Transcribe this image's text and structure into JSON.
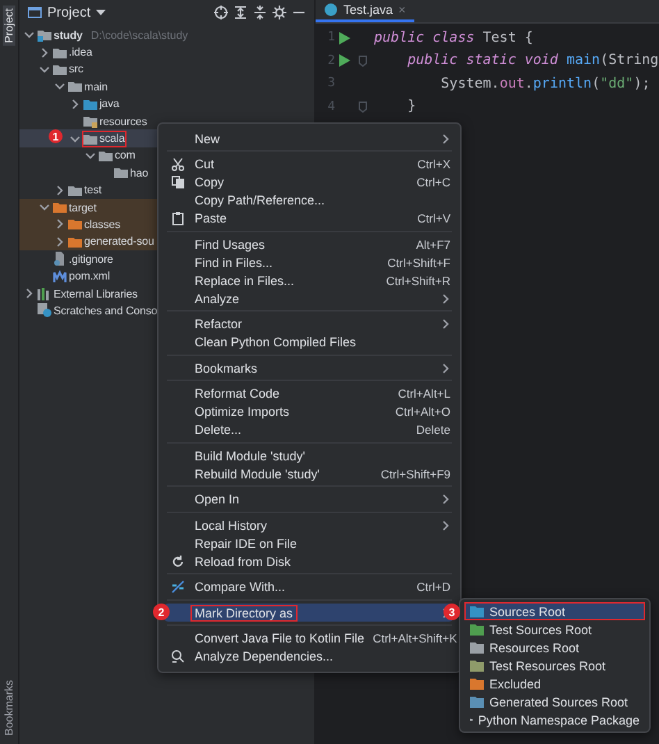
{
  "side_tabs": {
    "top": "Project",
    "bottom": "Bookmarks"
  },
  "project_panel": {
    "title": "Project"
  },
  "tree": [
    {
      "label": "study",
      "path": "D:\\code\\scala\\study",
      "kind": "module",
      "expanded": true,
      "selected": false,
      "outlined": false,
      "children": [
        {
          "label": ".idea",
          "kind": "folder",
          "expanded": false,
          "selected": false,
          "outlined": false
        },
        {
          "label": "src",
          "kind": "folder",
          "expanded": true,
          "selected": false,
          "outlined": false,
          "children": [
            {
              "label": "main",
              "kind": "folder",
              "expanded": true,
              "selected": false,
              "outlined": false,
              "children": [
                {
                  "label": "java",
                  "kind": "source",
                  "expanded": false,
                  "selected": false,
                  "outlined": false
                },
                {
                  "label": "resources",
                  "kind": "resource",
                  "selected": false,
                  "outlined": false
                },
                {
                  "label": "scala",
                  "kind": "folder",
                  "expanded": true,
                  "selected": true,
                  "outlined": true,
                  "children": [
                    {
                      "label": "com",
                      "kind": "folder",
                      "expanded": true,
                      "selected": false,
                      "outlined": false,
                      "children": [
                        {
                          "label": "hao",
                          "kind": "folder",
                          "selected": false,
                          "outlined": false
                        }
                      ]
                    }
                  ]
                }
              ]
            },
            {
              "label": "test",
              "kind": "folder",
              "expanded": false,
              "selected": false,
              "outlined": false
            }
          ]
        },
        {
          "label": "target",
          "kind": "excluded",
          "expanded": true,
          "selected": false,
          "outlined": false,
          "children": [
            {
              "label": "classes",
              "kind": "excluded",
              "expanded": false,
              "selected": false,
              "outlined": false
            },
            {
              "label": "generated-sou",
              "kind": "excluded",
              "expanded": false,
              "selected": false,
              "outlined": false
            }
          ]
        },
        {
          "label": ".gitignore",
          "kind": "gitfile",
          "selected": false,
          "outlined": false
        },
        {
          "label": "pom.xml",
          "kind": "maven",
          "selected": false,
          "outlined": false
        }
      ]
    },
    {
      "label": "External Libraries",
      "kind": "libraries",
      "expanded": false,
      "selected": false,
      "outlined": false
    },
    {
      "label": "Scratches and Conso",
      "kind": "scratches",
      "selected": false,
      "outlined": false
    }
  ],
  "editor_tab": {
    "label": "Test.java",
    "close": "×"
  },
  "code_lines": [
    {
      "number": "1",
      "run": true,
      "fold": false,
      "tokens": [
        {
          "text": "public class",
          "kind": "keyword"
        },
        {
          "text": " Test {",
          "kind": "plain"
        }
      ]
    },
    {
      "number": "2",
      "run": true,
      "fold": true,
      "tokens": [
        {
          "text": "    public static void",
          "kind": "keyword"
        },
        {
          "text": " main",
          "kind": "function"
        },
        {
          "text": "(String",
          "kind": "plain"
        }
      ]
    },
    {
      "number": "3",
      "run": false,
      "fold": false,
      "tokens": [
        {
          "text": "        System.",
          "kind": "plain"
        },
        {
          "text": "out",
          "kind": "field"
        },
        {
          "text": ".",
          "kind": "plain"
        },
        {
          "text": "println",
          "kind": "function"
        },
        {
          "text": "(",
          "kind": "plain"
        },
        {
          "text": "\"dd\"",
          "kind": "string"
        },
        {
          "text": ");",
          "kind": "plain"
        }
      ]
    },
    {
      "number": "4",
      "run": false,
      "fold": true,
      "tokens": [
        {
          "text": "    }",
          "kind": "plain"
        }
      ]
    }
  ],
  "context_menu": {
    "groups": [
      [
        {
          "label": "New",
          "submenu": true,
          "selected": false,
          "outlined": false
        }
      ],
      [
        {
          "label": "Cut",
          "shortcut": "Ctrl+X",
          "submenu": false,
          "selected": false,
          "outlined": false
        },
        {
          "label": "Copy",
          "shortcut": "Ctrl+C",
          "submenu": false,
          "selected": false,
          "outlined": false
        },
        {
          "label": "Copy Path/Reference...",
          "submenu": false,
          "selected": false,
          "outlined": false
        },
        {
          "label": "Paste",
          "shortcut": "Ctrl+V",
          "submenu": false,
          "selected": false,
          "outlined": false
        }
      ],
      [
        {
          "label": "Find Usages",
          "shortcut": "Alt+F7",
          "submenu": false,
          "selected": false,
          "outlined": false
        },
        {
          "label": "Find in Files...",
          "shortcut": "Ctrl+Shift+F",
          "submenu": false,
          "selected": false,
          "outlined": false
        },
        {
          "label": "Replace in Files...",
          "shortcut": "Ctrl+Shift+R",
          "submenu": false,
          "selected": false,
          "outlined": false
        },
        {
          "label": "Analyze",
          "submenu": true,
          "selected": false,
          "outlined": false
        }
      ],
      [
        {
          "label": "Refactor",
          "submenu": true,
          "selected": false,
          "outlined": false
        },
        {
          "label": "Clean Python Compiled Files",
          "submenu": false,
          "selected": false,
          "outlined": false
        }
      ],
      [
        {
          "label": "Bookmarks",
          "submenu": true,
          "selected": false,
          "outlined": false
        }
      ],
      [
        {
          "label": "Reformat Code",
          "shortcut": "Ctrl+Alt+L",
          "submenu": false,
          "selected": false,
          "outlined": false
        },
        {
          "label": "Optimize Imports",
          "shortcut": "Ctrl+Alt+O",
          "submenu": false,
          "selected": false,
          "outlined": false
        },
        {
          "label": "Delete...",
          "shortcut": "Delete",
          "submenu": false,
          "selected": false,
          "outlined": false
        }
      ],
      [
        {
          "label": "Build Module 'study'",
          "submenu": false,
          "selected": false,
          "outlined": false
        },
        {
          "label": "Rebuild Module 'study'",
          "shortcut": "Ctrl+Shift+F9",
          "submenu": false,
          "selected": false,
          "outlined": false
        }
      ],
      [
        {
          "label": "Open In",
          "submenu": true,
          "selected": false,
          "outlined": false
        }
      ],
      [
        {
          "label": "Local History",
          "submenu": true,
          "selected": false,
          "outlined": false
        },
        {
          "label": "Repair IDE on File",
          "submenu": false,
          "selected": false,
          "outlined": false
        },
        {
          "label": "Reload from Disk",
          "submenu": false,
          "selected": false,
          "outlined": false
        }
      ],
      [
        {
          "label": "Compare With...",
          "shortcut": "Ctrl+D",
          "submenu": false,
          "selected": false,
          "outlined": false
        }
      ],
      [
        {
          "label": "Mark Directory as",
          "submenu": true,
          "selected": true,
          "outlined": true
        }
      ],
      [
        {
          "label": "Convert Java File to Kotlin File",
          "shortcut": "Ctrl+Alt+Shift+K",
          "submenu": false,
          "selected": false,
          "outlined": false
        },
        {
          "label": "Analyze Dependencies...",
          "submenu": false,
          "selected": false,
          "outlined": false
        }
      ]
    ]
  },
  "submenu": {
    "items": [
      {
        "label": "Sources Root",
        "color": "#3592c4",
        "selected": true,
        "outlined": true
      },
      {
        "label": "Test Sources Root",
        "color": "#4f9e4f",
        "selected": false,
        "outlined": false
      },
      {
        "label": "Resources Root",
        "color": "#9aa0a6",
        "selected": false,
        "outlined": false
      },
      {
        "label": "Test Resources Root",
        "color": "#8f9b6a",
        "selected": false,
        "outlined": false
      },
      {
        "label": "Excluded",
        "color": "#d9772e",
        "selected": false,
        "outlined": false
      },
      {
        "label": "Generated Sources Root",
        "color": "#5a8fb4",
        "selected": false,
        "outlined": false
      },
      {
        "label": "Python Namespace Package",
        "color": "#a9adb3",
        "selected": false,
        "outlined": false
      }
    ]
  },
  "callouts": [
    "1",
    "2",
    "3"
  ]
}
